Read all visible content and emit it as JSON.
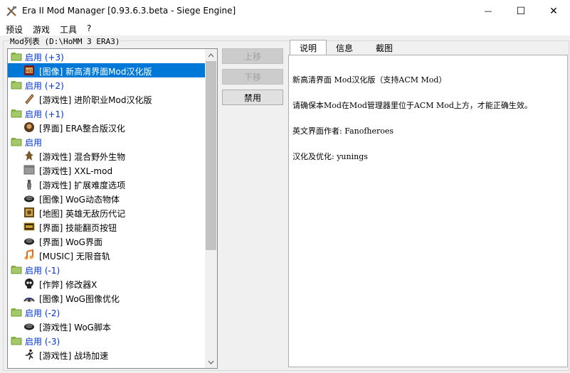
{
  "window": {
    "title": "Era II Mod Manager [0.93.6.3.beta - Siege Engine]",
    "minimize_glyph": "—",
    "maximize_glyph": "☐",
    "close_glyph": "✕"
  },
  "menu": [
    "预设",
    "游戏",
    "工具",
    "?"
  ],
  "modlist": {
    "label": "Mod列表 (D:\\HoMM 3 ERA3)",
    "rows": [
      {
        "type": "group",
        "label": "启用 (+3)",
        "icon": "folder-icon"
      },
      {
        "type": "mod",
        "label": "[图像] 新高清界面Mod汉化版",
        "icon": "hd-mod-icon",
        "selected": true
      },
      {
        "type": "group",
        "label": "启用 (+2)",
        "icon": "folder-icon"
      },
      {
        "type": "mod",
        "label": "[游戏性] 进阶职业Mod汉化版",
        "icon": "scroll-icon"
      },
      {
        "type": "group",
        "label": "启用 (+1)",
        "icon": "folder-icon"
      },
      {
        "type": "mod",
        "label": "[界面] ERA整合版汉化",
        "icon": "portrait-icon"
      },
      {
        "type": "group",
        "label": "启用",
        "icon": "folder-icon"
      },
      {
        "type": "mod",
        "label": "[游戏性] 混合野外生物",
        "icon": "creature-icon"
      },
      {
        "type": "mod",
        "label": "[游戏性] XXL-mod",
        "icon": "grey-box-icon"
      },
      {
        "type": "mod",
        "label": "[游戏性] 扩展难度选项",
        "icon": "knight-icon"
      },
      {
        "type": "mod",
        "label": "[图像] WoG动态物体",
        "icon": "wog-icon"
      },
      {
        "type": "mod",
        "label": "[地图] 英雄无敌历代记",
        "icon": "chronicles-icon"
      },
      {
        "type": "mod",
        "label": "[界面] 技能翻页按钮",
        "icon": "skill-button-icon"
      },
      {
        "type": "mod",
        "label": "[界面] WoG界面",
        "icon": "wog-icon"
      },
      {
        "type": "mod",
        "label": "[MUSIC] 无限音轨",
        "icon": "music-icon"
      },
      {
        "type": "group",
        "label": "启用 (-1)",
        "icon": "folder-icon"
      },
      {
        "type": "mod",
        "label": "[作弊] 修改器X",
        "icon": "skull-icon"
      },
      {
        "type": "mod",
        "label": "[图像] WoG图像优化",
        "icon": "fan-icon"
      },
      {
        "type": "group",
        "label": "启用 (-2)",
        "icon": "folder-icon"
      },
      {
        "type": "mod",
        "label": "[游戏性] WoG脚本",
        "icon": "wog-icon"
      },
      {
        "type": "group",
        "label": "启用 (-3)",
        "icon": "folder-icon"
      },
      {
        "type": "mod",
        "label": "[游戏性] 战场加速",
        "icon": "runner-icon"
      }
    ]
  },
  "buttons": {
    "move_up": "上移",
    "move_down": "下移",
    "disable": "禁用"
  },
  "tabs": [
    "说明",
    "信息",
    "截图"
  ],
  "description": {
    "lines": [
      "新高清界面 Mod汉化版（支持ACM Mod）",
      "请确保本Mod在Mod管理器里位于ACM Mod上方，才能正确生效。",
      "英文界面作者: Fanofheroes",
      "汉化及优化: yunings"
    ]
  },
  "colors": {
    "selection": "#0078d7",
    "group_text": "#0033cc",
    "folder": "#a5c96a"
  }
}
